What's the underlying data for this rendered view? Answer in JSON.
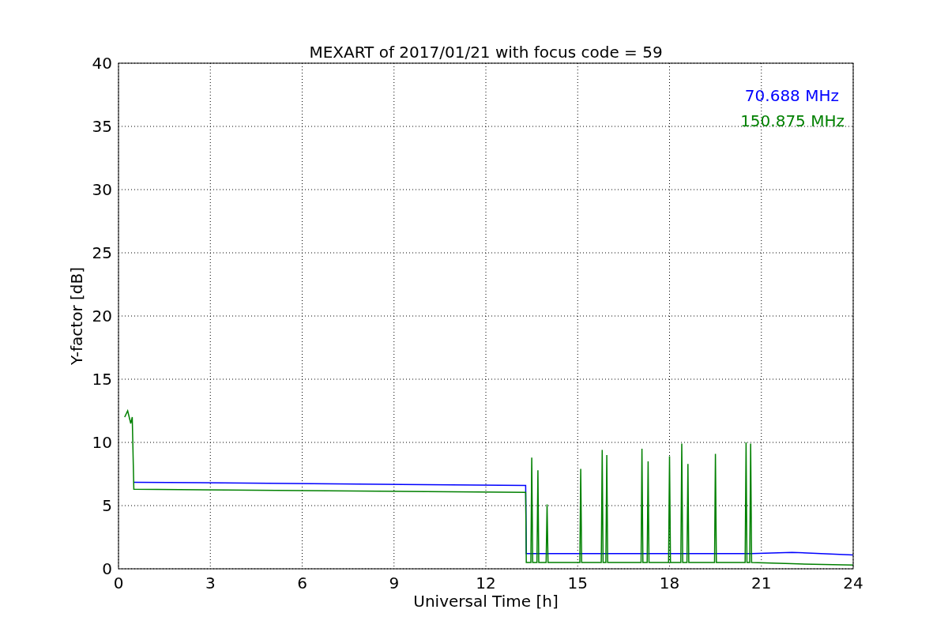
{
  "figure": {
    "chart_data": {
      "type": "line",
      "title": "MEXART of 2017/01/21 with focus code = 59",
      "xlabel": "Universal Time [h]",
      "ylabel": "Y-factor [dB]",
      "grid": true,
      "x": [
        0.2,
        0.3,
        0.4,
        0.45,
        0.5,
        13.3,
        13.32,
        13.47,
        13.5,
        13.53,
        13.67,
        13.7,
        13.73,
        13.97,
        14.0,
        14.03,
        15.07,
        15.1,
        15.13,
        15.77,
        15.8,
        15.83,
        15.92,
        15.95,
        15.98,
        17.07,
        17.1,
        17.13,
        17.27,
        17.3,
        17.33,
        17.97,
        18.0,
        18.03,
        18.37,
        18.4,
        18.43,
        18.57,
        18.6,
        18.63,
        19.47,
        19.5,
        19.53,
        20.47,
        20.5,
        20.53,
        20.62,
        20.65,
        20.68,
        22,
        24
      ],
      "series": [
        {
          "name": "70.688 MHz",
          "color": "#0000ff",
          "values": [
            null,
            null,
            null,
            null,
            6.85,
            6.6,
            1.2,
            1.2,
            1.2,
            1.2,
            1.2,
            1.2,
            1.2,
            1.2,
            1.2,
            1.2,
            1.2,
            1.2,
            1.2,
            1.2,
            1.2,
            1.2,
            1.2,
            1.2,
            1.2,
            1.2,
            1.2,
            1.2,
            1.2,
            1.2,
            1.2,
            1.2,
            1.2,
            1.2,
            1.2,
            1.2,
            1.2,
            1.2,
            1.2,
            1.2,
            1.2,
            1.2,
            1.2,
            1.2,
            1.2,
            1.2,
            1.2,
            1.2,
            1.2,
            1.3,
            1.1
          ]
        },
        {
          "name": "150.875 MHz",
          "color": "#008000",
          "values": [
            12,
            12.5,
            11.5,
            12,
            6.3,
            6.05,
            0.5,
            0.5,
            8.8,
            0.5,
            0.5,
            7.8,
            0.5,
            0.5,
            5.1,
            0.5,
            0.5,
            7.9,
            0.5,
            0.5,
            9.4,
            0.5,
            0.5,
            9.0,
            0.5,
            0.5,
            9.5,
            0.5,
            0.5,
            8.5,
            0.5,
            0.5,
            8.9,
            0.5,
            0.5,
            9.9,
            0.5,
            0.5,
            8.3,
            0.5,
            0.5,
            9.1,
            0.5,
            0.5,
            10.0,
            0.5,
            0.5,
            9.9,
            0.5,
            0.4,
            0.3
          ]
        }
      ],
      "xlim": [
        0,
        24
      ],
      "ylim": [
        0,
        40
      ],
      "xticks": [
        0,
        3,
        6,
        9,
        12,
        15,
        18,
        21,
        24
      ],
      "yticks": [
        0,
        5,
        10,
        15,
        20,
        25,
        30,
        35,
        40
      ]
    }
  }
}
